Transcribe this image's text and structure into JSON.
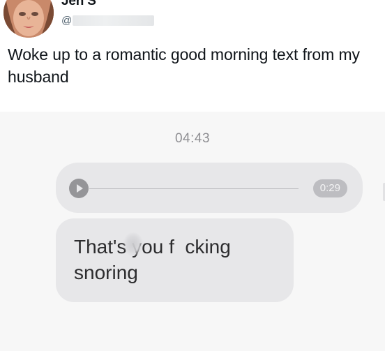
{
  "author": {
    "display_name": "Jen S",
    "handle_prefix": "@",
    "avatar_icon": "profile-photo"
  },
  "tweet": {
    "text": "Woke up to a romantic good morning text from my husband"
  },
  "attached_screenshot": {
    "timestamp": "04:43",
    "voice_message": {
      "duration": "0:29",
      "play_icon": "play-icon",
      "progress": 0.0
    },
    "text_message": {
      "line1": "That's you f  cking",
      "line2": "snoring"
    }
  },
  "colors": {
    "bubble": "#e7e7e9",
    "timestamp": "#8e8e92",
    "text": "#0f1419",
    "handle": "#536471"
  }
}
